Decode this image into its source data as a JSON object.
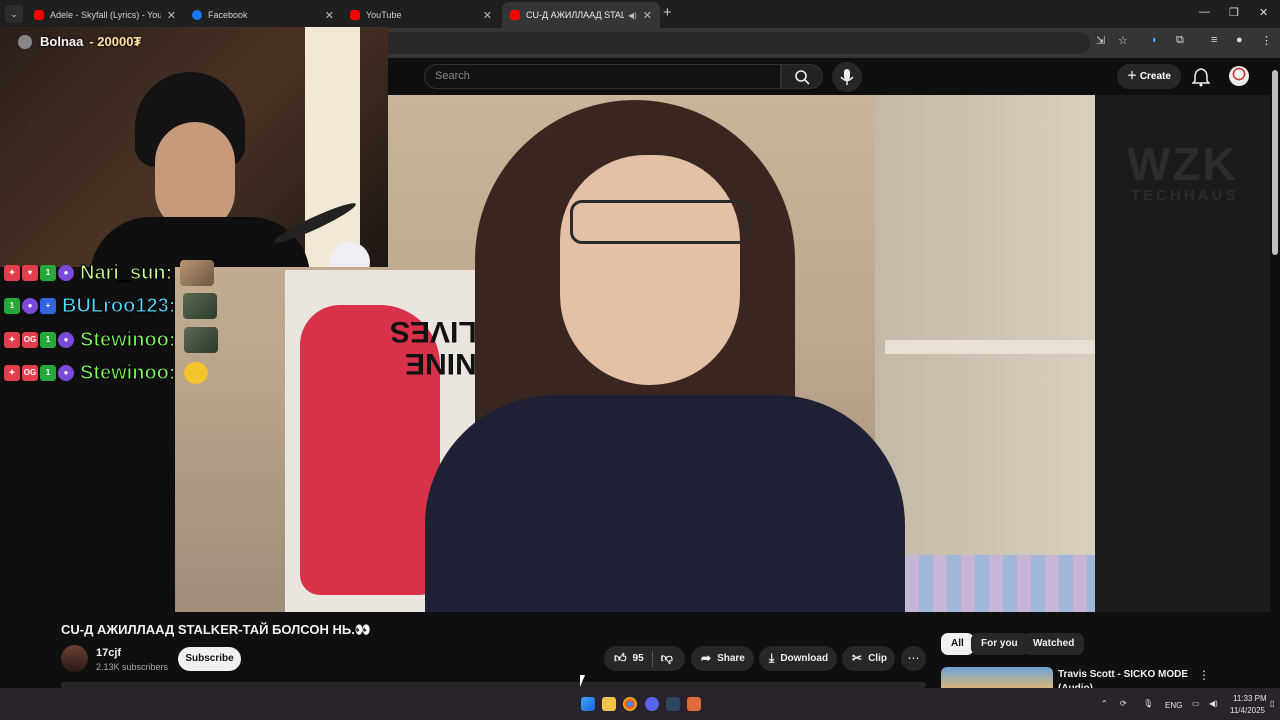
{
  "browser": {
    "tabs": [
      {
        "title": "Adele - Skyfall (Lyrics) - YouTube",
        "favicon": "youtube-icon"
      },
      {
        "title": "Facebook",
        "favicon": "facebook-icon"
      },
      {
        "title": "YouTube",
        "favicon": "youtube-icon"
      },
      {
        "title": "CU-Д АЖИЛЛААД STALKER-ТАЙ БОЛСОН НЬ",
        "favicon": "youtube-icon",
        "active": true,
        "audio": true
      }
    ]
  },
  "masthead": {
    "search_placeholder": "Search",
    "create_label": "Create"
  },
  "stream_overlay": {
    "streamer_name": "Bolnaa",
    "donation": "- 20000₮",
    "chat": [
      {
        "user": "Nari_sun:",
        "color": "#c6ff8a",
        "badges": [
          "rocket",
          "heart",
          "1st",
          "mask"
        ],
        "emote": "cat"
      },
      {
        "user": "BULroo123:",
        "color": "#57d7ff",
        "badges": [
          "1st",
          "mask",
          "flag"
        ],
        "emote": "frog"
      },
      {
        "user": "Stewinoo:",
        "color": "#7dff5a",
        "badges": [
          "rocket",
          "OG",
          "1st",
          "mask"
        ],
        "emote": "frog"
      },
      {
        "user": "Stewinoo:",
        "color": "#7dff5a",
        "badges": [
          "rocket",
          "OG",
          "1st",
          "mask"
        ],
        "emote": "duck"
      }
    ]
  },
  "video": {
    "side_brand_line1": "WZK",
    "side_brand_line2": "TECHHAUS",
    "poster_text": "NINE\nLIVES"
  },
  "below_video": {
    "title": "CU-Д АЖИЛЛААД STALKER-ТАЙ БОЛСОН НЬ.👀",
    "channel_name": "17cjf",
    "subscribers": "2.13K subscribers",
    "subscribe_label": "Subscribe",
    "like_count": "95",
    "share_label": "Share",
    "download_label": "Download",
    "clip_label": "Clip"
  },
  "recommendations": {
    "chips": [
      "All",
      "For you",
      "Watched"
    ],
    "active_chip": "All",
    "first_item_title": "Travis Scott - SICKO MODE (Audio)"
  },
  "taskbar": {
    "language": "ENG",
    "time": "11:33 PM",
    "date": "11/4/2025"
  },
  "colors": {
    "youtube_red": "#ff0000",
    "facebook_blue": "#1877f2",
    "page_bg": "#0f0f0f"
  }
}
